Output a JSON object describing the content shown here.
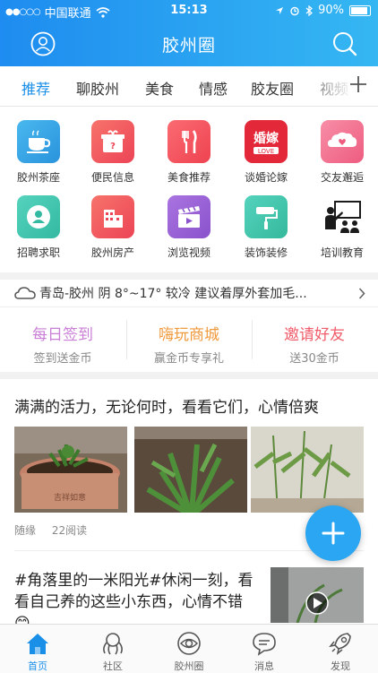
{
  "status_bar": {
    "carrier": "中国联通",
    "time": "15:13",
    "battery": "90%"
  },
  "header": {
    "title": "胶州圈"
  },
  "tabs": [
    {
      "label": "推荐",
      "active": true
    },
    {
      "label": "聊胶州"
    },
    {
      "label": "美食"
    },
    {
      "label": "情感"
    },
    {
      "label": "胶友圈"
    },
    {
      "label": "视频"
    }
  ],
  "grid": [
    {
      "label": "胶州茶座",
      "icon": "teacup-icon",
      "color": "#3aa9e8"
    },
    {
      "label": "便民信息",
      "icon": "gift-icon",
      "color": "#f0565f"
    },
    {
      "label": "美食推荐",
      "icon": "fork-knife-icon",
      "color": "#f65a62"
    },
    {
      "label": "谈婚论嫁",
      "icon": "wedding-icon",
      "color": "#e8293a"
    },
    {
      "label": "交友邂逅",
      "icon": "hearts-cloud-icon",
      "color": "#f46c8e"
    },
    {
      "label": "招聘求职",
      "icon": "job-icon",
      "color": "#3ec7b0"
    },
    {
      "label": "胶州房产",
      "icon": "building-icon",
      "color": "#f0555f"
    },
    {
      "label": "浏览视频",
      "icon": "clapper-icon",
      "color": "#9a63d6"
    },
    {
      "label": "装饰装修",
      "icon": "paint-roller-icon",
      "color": "#3fc7a6"
    },
    {
      "label": "培训教育",
      "icon": "teacher-icon",
      "color": "#1b1b1b"
    }
  ],
  "weather": {
    "text": "青岛-胶州 阴 8°~17° 较冷 建议着厚外套加毛..."
  },
  "promos": [
    {
      "title": "每日签到",
      "subtitle": "签到送金币",
      "color": "#c97fd6"
    },
    {
      "title": "嗨玩商城",
      "subtitle": "赢金币专享礼",
      "color": "#f09a3e"
    },
    {
      "title": "邀请好友",
      "subtitle": "送30金币",
      "color": "#f05c6a"
    }
  ],
  "post1": {
    "title": "满满的活力，无论何时，看看它们，心情倍爽",
    "author": "随缘",
    "reads": "22阅读"
  },
  "post2": {
    "title": "#角落里的一米阳光#休闲一刻，看看自己养的这些小东西，心情不错😊"
  },
  "tabbar": [
    {
      "label": "首页",
      "icon": "home-icon",
      "active": true
    },
    {
      "label": "社区",
      "icon": "community-icon"
    },
    {
      "label": "胶州圈",
      "icon": "circle-eye-icon"
    },
    {
      "label": "消息",
      "icon": "message-icon"
    },
    {
      "label": "发现",
      "icon": "rocket-icon"
    }
  ],
  "colors": {
    "accent": "#1a8fe8",
    "header_start": "#1e8cf0",
    "header_end": "#35b7f2"
  }
}
